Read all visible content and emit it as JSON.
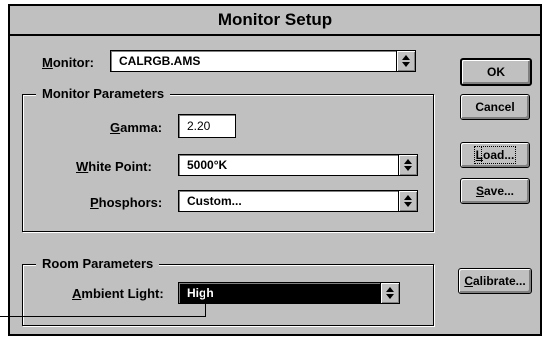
{
  "window": {
    "title": "Monitor Setup"
  },
  "monitor": {
    "label_u": "M",
    "label_rest": "onitor:",
    "value": "CALRGB.AMS"
  },
  "monitor_params": {
    "group_label": "Monitor Parameters",
    "gamma": {
      "label_u": "G",
      "label_rest": "amma:",
      "value": "2.20"
    },
    "white_point": {
      "label_u": "W",
      "label_rest": "hite Point:",
      "value": "5000°K"
    },
    "phosphors": {
      "label_u": "P",
      "label_rest": "hosphors:",
      "value": "Custom..."
    }
  },
  "room_params": {
    "group_label": "Room Parameters",
    "ambient_light": {
      "label_u": "A",
      "label_rest": "mbient Light:",
      "value": "High"
    }
  },
  "buttons": {
    "ok": "OK",
    "cancel": "Cancel",
    "load_u": "L",
    "load_rest": "oad...",
    "save_u": "S",
    "save_rest": "ave...",
    "calibrate_u": "C",
    "calibrate_rest": "alibrate..."
  },
  "icons": {
    "dropdown": "updown-arrow-icon"
  }
}
